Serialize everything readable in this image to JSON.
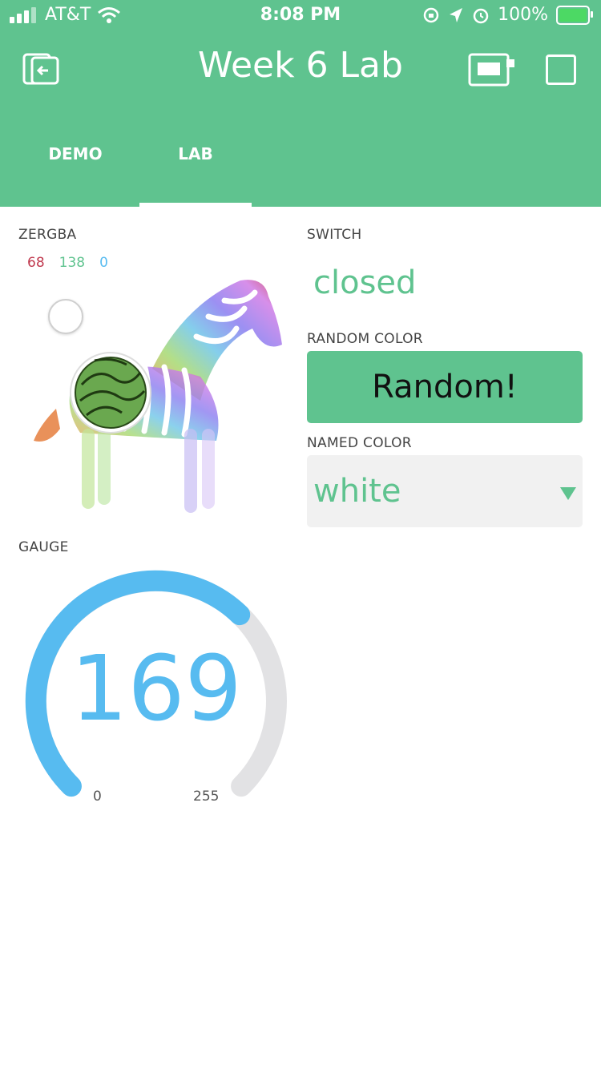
{
  "status_bar": {
    "carrier": "AT&T",
    "time": "8:08 PM",
    "battery": "100%"
  },
  "header": {
    "title": "Week 6 Lab",
    "background_color": "#5fc38f"
  },
  "tabs": [
    {
      "label": "DEMO",
      "active": false
    },
    {
      "label": "LAB",
      "active": true
    }
  ],
  "zergba": {
    "label": "ZERGBA",
    "r": "68",
    "g": "138",
    "b": "0",
    "r_color": "#c0394e",
    "g_color": "#5fc38f",
    "b_color": "#57bbf0",
    "selected_color": "#448a00"
  },
  "switch": {
    "label": "SWITCH",
    "value": "closed"
  },
  "random_color": {
    "label": "RANDOM COLOR",
    "button_label": "Random!"
  },
  "named_color": {
    "label": "NAMED COLOR",
    "selected": "white"
  },
  "gauge": {
    "label": "GAUGE",
    "value": "169",
    "min": "0",
    "max": "255",
    "fill_fraction": 0.663,
    "fill_color": "#57bbf0",
    "track_color": "#e2e2e4"
  },
  "icons": [
    "signal-icon",
    "wifi-icon",
    "rotation-lock-icon",
    "location-icon",
    "alarm-icon",
    "battery-icon",
    "back-icon",
    "device-icon",
    "square-icon",
    "chevron-down-icon"
  ]
}
